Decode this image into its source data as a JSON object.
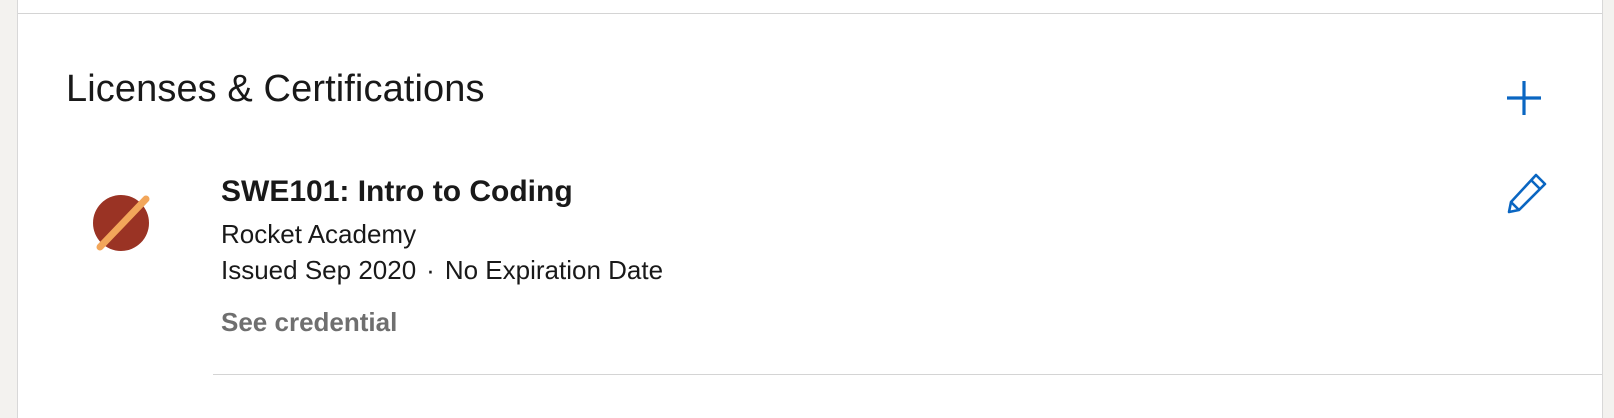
{
  "section": {
    "title": "Licenses & Certifications",
    "add_icon": "plus-icon"
  },
  "certification": {
    "title": "SWE101: Intro to Coding",
    "issuer": "Rocket Academy",
    "issued": "Issued Sep 2020",
    "separator": "·",
    "expiration": "No Expiration Date",
    "credential_link": "See credential",
    "logo_icon": "rocket-academy-logo",
    "edit_icon": "pencil-icon"
  },
  "colors": {
    "accent": "#0a66c2",
    "logo_circle": "#9a3324",
    "logo_pencil": "#f2a65a",
    "muted_text": "#6f6f6f"
  }
}
